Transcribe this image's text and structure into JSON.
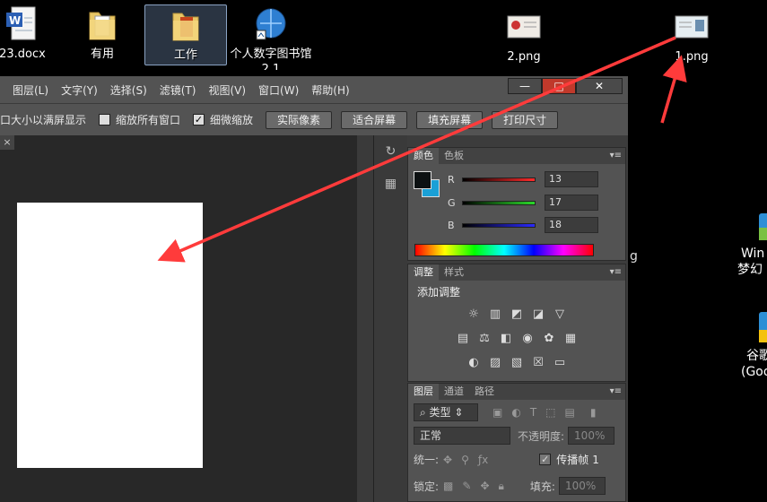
{
  "desktop": {
    "icons": [
      {
        "label": "23.docx"
      },
      {
        "label": "有用"
      },
      {
        "label": "工作"
      },
      {
        "label": "个人数字图书馆2.1"
      },
      {
        "label": "2.png"
      },
      {
        "label": "1.png"
      }
    ],
    "right_items": [
      "Win",
      "梦幻",
      "谷歌",
      "(Goo"
    ],
    "stray_text": "g"
  },
  "photoshop": {
    "menu": [
      "图层(L)",
      "文字(Y)",
      "选择(S)",
      "滤镜(T)",
      "视图(V)",
      "窗口(W)",
      "帮助(H)"
    ],
    "window_buttons": {
      "minimize": "—",
      "maximize": "□",
      "close": "✕"
    },
    "options": {
      "fit_text": "口大小以满屏显示",
      "zoom_all_windows": "缩放所有窗口",
      "scrubby_zoom": "细微缩放",
      "actual_pixels": "实际像素",
      "fit_screen": "适合屏幕",
      "fill_screen": "填充屏幕",
      "print_size": "打印尺寸"
    },
    "doc_tab_close": "×",
    "color_panel": {
      "tabs": [
        "颜色",
        "色板"
      ],
      "channels": [
        {
          "name": "R",
          "value": "13",
          "color": "#ff2a2a"
        },
        {
          "name": "G",
          "value": "17",
          "color": "#2ad92a"
        },
        {
          "name": "B",
          "value": "18",
          "color": "#2a2aff"
        }
      ],
      "foreground": "#0d1112",
      "background": "#1aa0d6"
    },
    "adjust_panel": {
      "tabs": [
        "调整",
        "样式"
      ],
      "title": "添加调整"
    },
    "layers_panel": {
      "tabs": [
        "图层",
        "通道",
        "路径"
      ],
      "filter_label": "类型",
      "blend_mode": "正常",
      "opacity_label": "不透明度:",
      "opacity_value": "100%",
      "unify_label": "统一:",
      "propagate_label": "传播帧",
      "propagate_value": "1",
      "lock_label": "锁定:",
      "fill_label": "填充:",
      "fill_value": "100%"
    }
  },
  "annotations": {
    "arrow_color": "#ff3b3b"
  }
}
